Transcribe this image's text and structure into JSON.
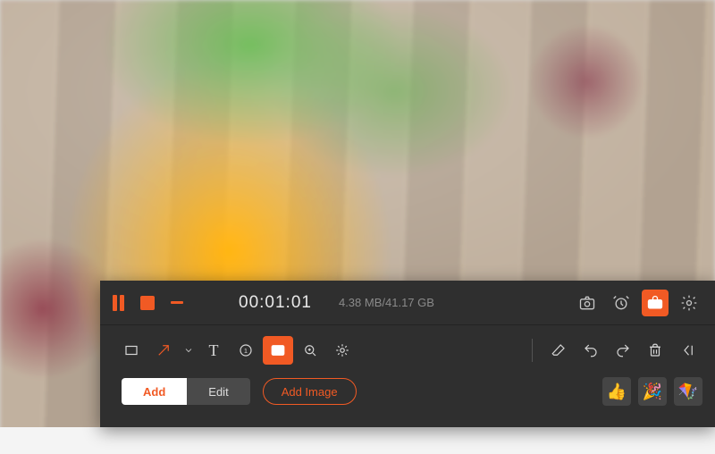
{
  "recorder": {
    "timer": "00:01:01",
    "storage": "4.38 MB/41.17 GB"
  },
  "tabs": {
    "add_label": "Add",
    "edit_label": "Edit",
    "add_image_label": "Add Image"
  },
  "stickers": {
    "a": "👍",
    "b": "🎉",
    "c": "🪁"
  }
}
